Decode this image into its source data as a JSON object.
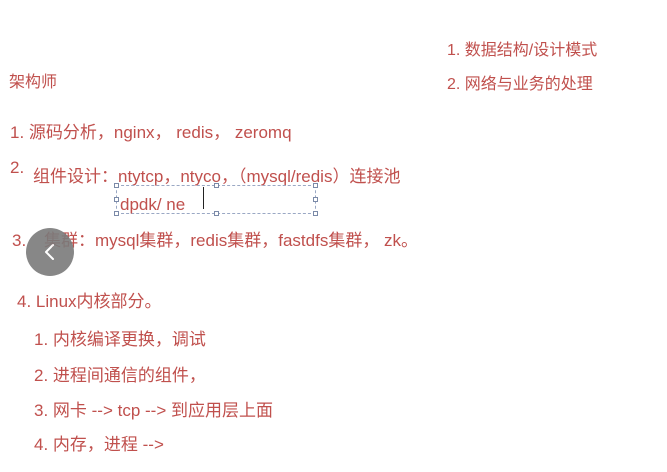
{
  "colors": {
    "text_red": "#c0504d",
    "nav_button_bg": "#7b7b7b"
  },
  "icons": {
    "nav_prev": "chevron-left-icon"
  },
  "title": "架构师",
  "top_right": [
    "1. 数据结构/设计模式",
    "2. 网络与业务的处理"
  ],
  "items": [
    "1. 源码分析，nginx， redis， zeromq",
    "2.",
    "组件设计：ntytcp，ntyco，（mysql/redis）连接池",
    "dpdk/ ne",
    "3.",
    "集群：mysql集群，redis集群，fastdfs集群， zk。",
    "4. Linux内核部分。"
  ],
  "subitems": [
    "1. 内核编译更换，调试",
    "2. 进程间通信的组件，",
    "3. 网卡 --> tcp --> 到应用层上面",
    "4. 内存，进程 -->"
  ]
}
